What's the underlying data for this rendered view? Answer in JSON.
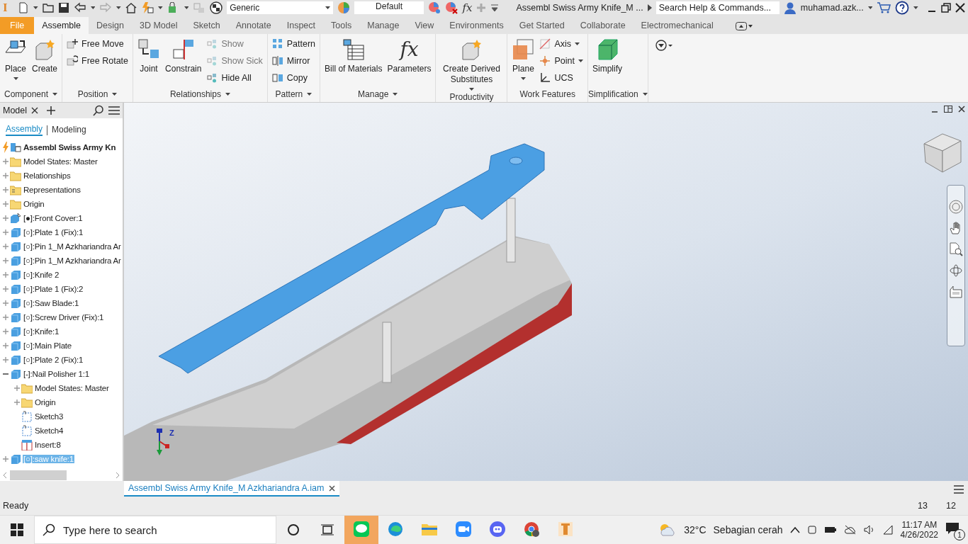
{
  "app": {
    "logo": "I"
  },
  "quick_access": {
    "material": "Generic",
    "appearance": "Default",
    "fx": "fx"
  },
  "title": "Assembl Swiss Army Knife_M ...",
  "help_search": {
    "placeholder": "Search Help & Commands..."
  },
  "user": "muhamad.azk...",
  "menu_tabs": [
    {
      "label": "File",
      "kind": "file",
      "selected": false
    },
    {
      "label": "Assemble",
      "kind": "tab",
      "selected": true
    },
    {
      "label": "Design",
      "kind": "tab",
      "selected": false
    },
    {
      "label": "3D Model",
      "kind": "tab",
      "selected": false
    },
    {
      "label": "Sketch",
      "kind": "tab",
      "selected": false
    },
    {
      "label": "Annotate",
      "kind": "tab",
      "selected": false
    },
    {
      "label": "Inspect",
      "kind": "tab",
      "selected": false
    },
    {
      "label": "Tools",
      "kind": "tab",
      "selected": false
    },
    {
      "label": "Manage",
      "kind": "tab",
      "selected": false
    },
    {
      "label": "View",
      "kind": "tab",
      "selected": false
    },
    {
      "label": "Environments",
      "kind": "tab",
      "selected": false
    },
    {
      "label": "Get Started",
      "kind": "tab",
      "selected": false
    },
    {
      "label": "Collaborate",
      "kind": "tab",
      "selected": false
    },
    {
      "label": "Electromechanical",
      "kind": "tab",
      "selected": false
    }
  ],
  "ribbon": [
    {
      "title": "Component",
      "menu": true,
      "tools": [
        {
          "kind": "large",
          "label": "Place",
          "dropdown": true,
          "disabled": false
        },
        {
          "kind": "large",
          "label": "Create",
          "disabled": false
        }
      ]
    },
    {
      "title": "Position",
      "menu": true,
      "tools": [
        {
          "kind": "small",
          "label": "Free Move",
          "disabled": false
        },
        {
          "kind": "small",
          "label": "Free Rotate",
          "disabled": false
        }
      ]
    },
    {
      "title": "Relationships",
      "menu": true,
      "tools": [
        {
          "kind": "large",
          "label": "Joint",
          "disabled": false
        },
        {
          "kind": "large",
          "label": "Constrain",
          "disabled": false
        },
        {
          "kind": "small",
          "label": "Show",
          "disabled": true
        },
        {
          "kind": "small",
          "label": "Show Sick",
          "disabled": true
        },
        {
          "kind": "small",
          "label": "Hide All",
          "disabled": false
        }
      ]
    },
    {
      "title": "Pattern",
      "menu": true,
      "tools": [
        {
          "kind": "small",
          "label": "Pattern",
          "disabled": false
        },
        {
          "kind": "small",
          "label": "Mirror",
          "disabled": false
        },
        {
          "kind": "small",
          "label": "Copy",
          "disabled": false
        }
      ]
    },
    {
      "title": "Manage",
      "menu": true,
      "tools": [
        {
          "kind": "large",
          "label": "Bill of Materials",
          "disabled": false
        },
        {
          "kind": "large",
          "label": "Parameters",
          "glyph": "fx",
          "disabled": false
        }
      ]
    },
    {
      "title": "Productivity",
      "menu": false,
      "tools": [
        {
          "kind": "large",
          "label": "Create Derived Substitutes",
          "dropdown": true,
          "disabled": false
        }
      ]
    },
    {
      "title": "Work Features",
      "menu": false,
      "tools": [
        {
          "kind": "large",
          "label": "Plane",
          "dropdown": true,
          "disabled": false
        },
        {
          "kind": "small",
          "label": "Axis",
          "dropdown": true,
          "disabled": false
        },
        {
          "kind": "small",
          "label": "Point",
          "dropdown": true,
          "disabled": false
        },
        {
          "kind": "small",
          "label": "UCS",
          "disabled": false
        }
      ]
    },
    {
      "title": "Simplification",
      "menu": true,
      "tools": [
        {
          "kind": "large",
          "label": "Simplify",
          "disabled": false
        }
      ]
    }
  ],
  "browser": {
    "tab": "Model",
    "views": [
      {
        "label": "Assembly",
        "selected": true
      },
      {
        "label": "Modeling",
        "selected": false
      }
    ],
    "root": {
      "label": "Assembl Swiss Army Kn",
      "children": [
        {
          "label": "Model States: Master",
          "kind": "folder",
          "expanded": false,
          "selected": false
        },
        {
          "label": "Relationships",
          "kind": "folder",
          "expanded": false,
          "selected": false
        },
        {
          "label": "Representations",
          "kind": "representations",
          "expanded": false,
          "selected": false
        },
        {
          "label": "Origin",
          "kind": "folder",
          "expanded": false,
          "selected": false
        },
        {
          "label": "[●]:Front Cover:1",
          "kind": "part-pinned",
          "expanded": false,
          "selected": false
        },
        {
          "label": "[○]:Plate 1 (Fix):1",
          "kind": "part",
          "expanded": false,
          "selected": false
        },
        {
          "label": "[○]:Pin 1_M Azkhariandra Ar",
          "kind": "part",
          "expanded": false,
          "selected": false
        },
        {
          "label": "[○]:Pin 1_M Azkhariandra Ar",
          "kind": "part",
          "expanded": false,
          "selected": false
        },
        {
          "label": "[○]:Knife 2",
          "kind": "part",
          "expanded": false,
          "selected": false
        },
        {
          "label": "[○]:Plate 1 (Fix):2",
          "kind": "part",
          "expanded": false,
          "selected": false
        },
        {
          "label": "[○]:Saw Blade:1",
          "kind": "part",
          "expanded": false,
          "selected": false
        },
        {
          "label": "[○]:Screw Driver (Fix):1",
          "kind": "part",
          "expanded": false,
          "selected": false
        },
        {
          "label": "[○]:Knife:1",
          "kind": "part",
          "expanded": false,
          "selected": false
        },
        {
          "label": "[○]:Main Plate",
          "kind": "part",
          "expanded": false,
          "selected": false
        },
        {
          "label": "[○]:Plate 2 (Fix):1",
          "kind": "part",
          "expanded": false,
          "selected": false
        },
        {
          "label": "[-]:Nail Polisher 1:1",
          "kind": "part",
          "expanded": true,
          "selected": false,
          "children": [
            {
              "label": "Model States: Master",
              "kind": "folder",
              "expanded": false,
              "selected": false
            },
            {
              "label": "Origin",
              "kind": "folder",
              "expanded": false,
              "selected": false
            },
            {
              "label": "Sketch3",
              "kind": "sketch",
              "selected": false
            },
            {
              "label": "Sketch4",
              "kind": "sketch",
              "selected": false
            },
            {
              "label": "Insert:8",
              "kind": "insert",
              "selected": false
            }
          ]
        },
        {
          "label": "[○]:saw knife:1",
          "kind": "part",
          "expanded": false,
          "selected": true
        }
      ]
    }
  },
  "viewport": {
    "triad_label": "Z",
    "document_tab": {
      "label": "Assembl Swiss Army Knife_M Azkhariandra A.iam",
      "selected": true
    }
  },
  "status_bar": {
    "text": "Ready",
    "counts": [
      "13",
      "12"
    ]
  },
  "taskbar": {
    "search": {
      "placeholder": "Type here to search"
    },
    "apps": [
      {
        "kind": "line",
        "active": true
      },
      {
        "kind": "edge",
        "active": false
      },
      {
        "kind": "explorer",
        "active": false
      },
      {
        "kind": "zoom",
        "active": false
      },
      {
        "kind": "discord",
        "active": false
      },
      {
        "kind": "chrome",
        "active": false
      },
      {
        "kind": "inventor",
        "active": false
      }
    ],
    "temperature": "32°C",
    "weather": "Sebagian cerah",
    "time": "11:17 AM",
    "date": "4/26/2022",
    "notifications": "1"
  }
}
